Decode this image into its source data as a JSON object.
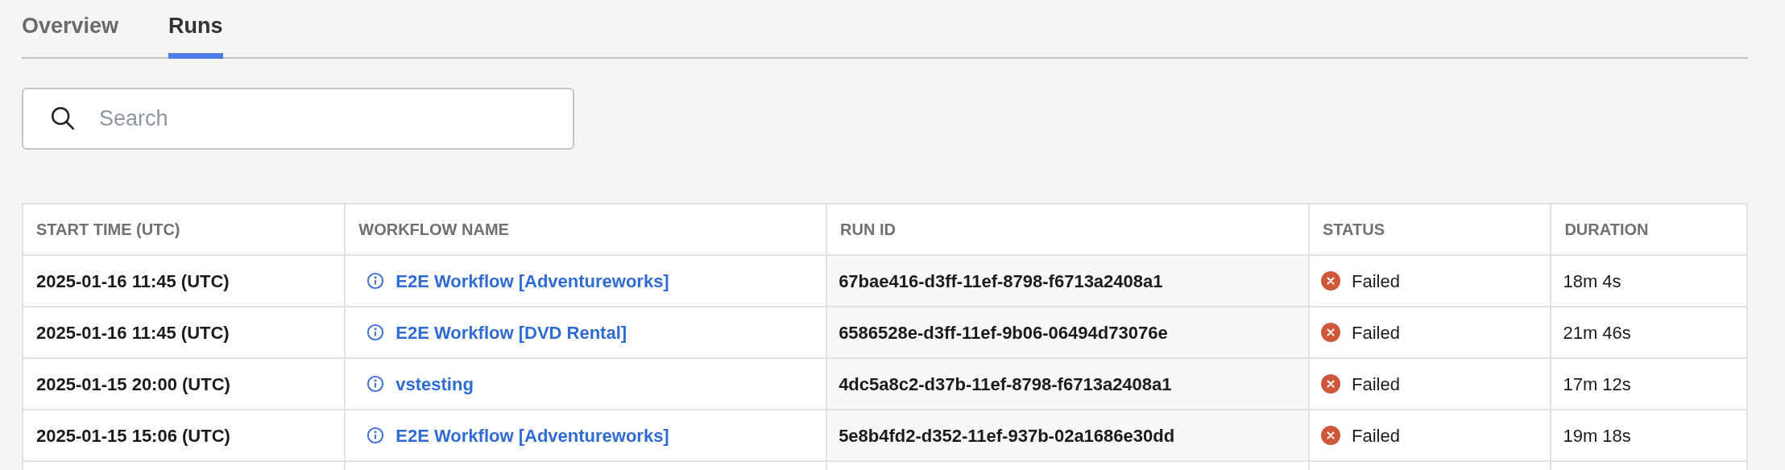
{
  "tabs": [
    {
      "label": "Overview",
      "selected": false
    },
    {
      "label": "Runs",
      "selected": true
    }
  ],
  "search": {
    "placeholder": "Search"
  },
  "table": {
    "columns": [
      "START TIME (UTC)",
      "WORKFLOW NAME",
      "RUN ID",
      "STATUS",
      "DURATION"
    ],
    "rows": [
      {
        "start_time": "2025-01-16 11:45 (UTC)",
        "workflow_name": "E2E Workflow [Adventureworks]",
        "run_id": "67bae416-d3ff-11ef-8798-f6713a2408a1",
        "status": {
          "kind": "failed",
          "label": "Failed"
        },
        "duration": "18m 4s"
      },
      {
        "start_time": "2025-01-16 11:45 (UTC)",
        "workflow_name": "E2E Workflow [DVD Rental]",
        "run_id": "6586528e-d3ff-11ef-9b06-06494d73076e",
        "status": {
          "kind": "failed",
          "label": "Failed"
        },
        "duration": "21m 46s"
      },
      {
        "start_time": "2025-01-15 20:00 (UTC)",
        "workflow_name": "vstesting",
        "run_id": "4dc5a8c2-d37b-11ef-8798-f6713a2408a1",
        "status": {
          "kind": "failed",
          "label": "Failed"
        },
        "duration": "17m 12s"
      },
      {
        "start_time": "2025-01-15 15:06 (UTC)",
        "workflow_name": "E2E Workflow [Adventureworks]",
        "run_id": "5e8b4fd2-d352-11ef-937b-02a1686e30dd",
        "status": {
          "kind": "failed",
          "label": "Failed"
        },
        "duration": "19m 18s"
      }
    ]
  }
}
